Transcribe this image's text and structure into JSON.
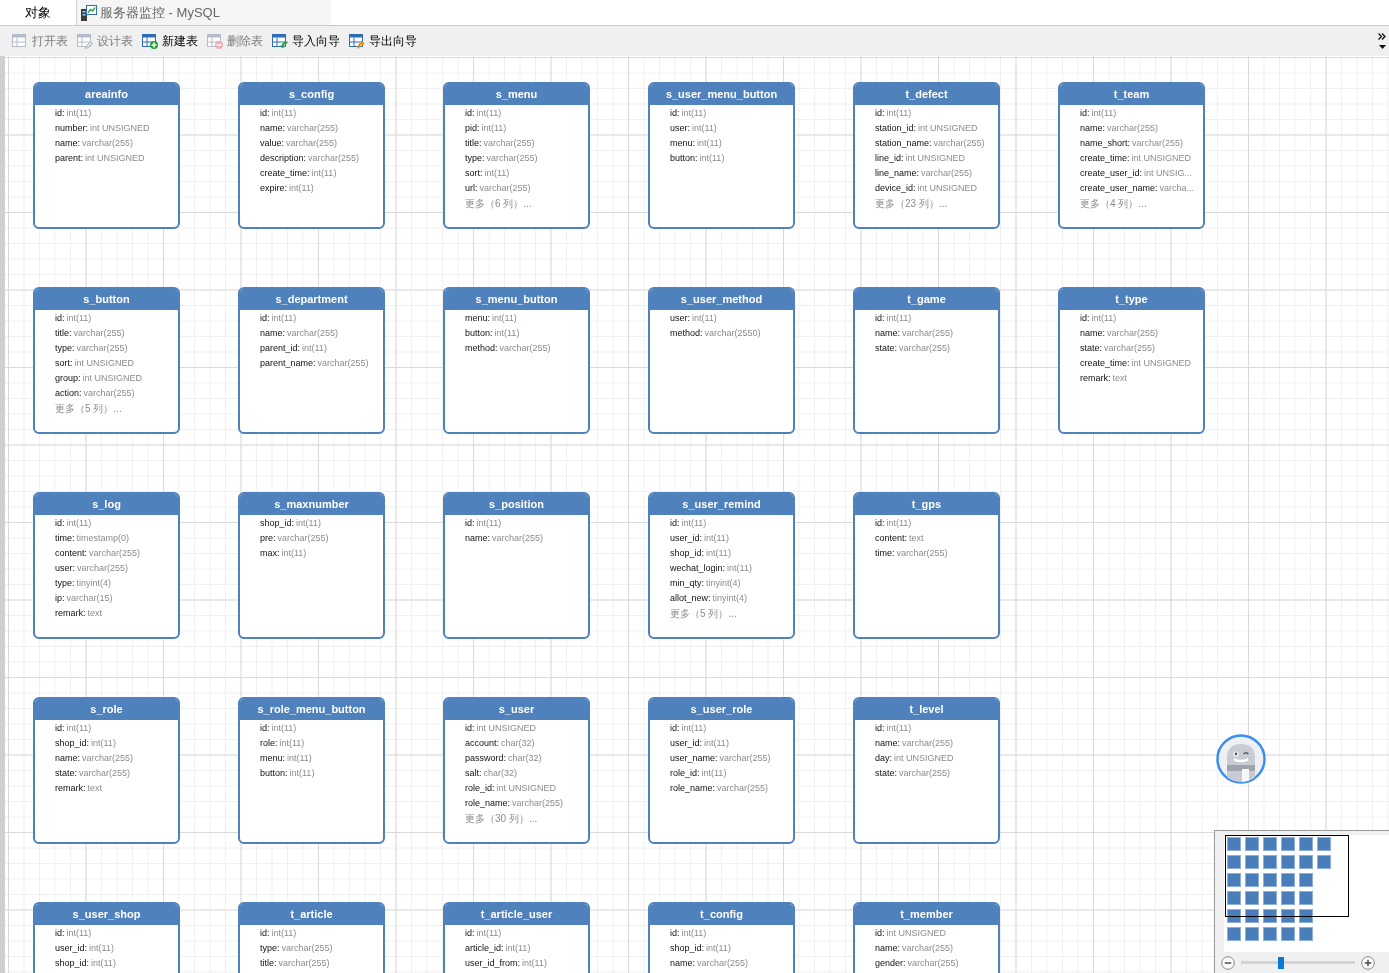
{
  "tabs": [
    {
      "label": "对象",
      "selected": true,
      "kind": "objects"
    },
    {
      "label": "服务器监控 - MySQL",
      "selected": false,
      "kind": "server-monitor"
    }
  ],
  "toolbar": [
    {
      "label": "打开表",
      "kind": "open",
      "disabled": true
    },
    {
      "label": "设计表",
      "kind": "design",
      "disabled": true
    },
    {
      "label": "新建表",
      "kind": "new",
      "disabled": false
    },
    {
      "label": "删除表",
      "kind": "delete",
      "disabled": true
    },
    {
      "label": "导入向导",
      "kind": "import",
      "disabled": false
    },
    {
      "label": "导出向导",
      "kind": "export",
      "disabled": false
    }
  ],
  "table_rows": [
    [
      {
        "name": "areainfo",
        "fields": [
          {
            "name": "id:",
            "type": "int(11)"
          },
          {
            "name": "number:",
            "type": "int UNSIGNED"
          },
          {
            "name": "name:",
            "type": "varchar(255)"
          },
          {
            "name": "parent:",
            "type": "int UNSIGNED"
          }
        ]
      },
      {
        "name": "s_config",
        "fields": [
          {
            "name": "id:",
            "type": "int(11)"
          },
          {
            "name": "name:",
            "type": "varchar(255)"
          },
          {
            "name": "value:",
            "type": "varchar(255)"
          },
          {
            "name": "description:",
            "type": "varchar(255)"
          },
          {
            "name": "create_time:",
            "type": "int(11)"
          },
          {
            "name": "expire:",
            "type": "int(11)"
          }
        ]
      },
      {
        "name": "s_menu",
        "fields": [
          {
            "name": "id:",
            "type": "int(11)"
          },
          {
            "name": "pid:",
            "type": "int(11)"
          },
          {
            "name": "title:",
            "type": "varchar(255)"
          },
          {
            "name": "type:",
            "type": "varchar(255)"
          },
          {
            "name": "sort:",
            "type": "int(11)"
          },
          {
            "name": "url:",
            "type": "varchar(255)"
          }
        ],
        "more": "更多（6 列）..."
      },
      {
        "name": "s_user_menu_button",
        "fields": [
          {
            "name": "id:",
            "type": "int(11)"
          },
          {
            "name": "user:",
            "type": "int(11)"
          },
          {
            "name": "menu:",
            "type": "int(11)"
          },
          {
            "name": "button:",
            "type": "int(11)"
          }
        ]
      },
      {
        "name": "t_defect",
        "fields": [
          {
            "name": "id:",
            "type": "int(11)"
          },
          {
            "name": "station_id:",
            "type": "int UNSIGNED"
          },
          {
            "name": "station_name:",
            "type": "varchar(255)"
          },
          {
            "name": "line_id:",
            "type": "int UNSIGNED"
          },
          {
            "name": "line_name:",
            "type": "varchar(255)"
          },
          {
            "name": "device_id:",
            "type": "int UNSIGNED"
          }
        ],
        "more": "更多（23 列）..."
      },
      {
        "name": "t_team",
        "fields": [
          {
            "name": "id:",
            "type": "int(11)"
          },
          {
            "name": "name:",
            "type": "varchar(255)"
          },
          {
            "name": "name_short:",
            "type": "varchar(255)"
          },
          {
            "name": "create_time:",
            "type": "int UNSIGNED"
          },
          {
            "name": "create_user_id:",
            "type": "int UNSIG..."
          },
          {
            "name": "create_user_name:",
            "type": "varcha..."
          }
        ],
        "more": "更多（4 列）..."
      }
    ],
    [
      {
        "name": "s_button",
        "fields": [
          {
            "name": "id:",
            "type": "int(11)"
          },
          {
            "name": "title:",
            "type": "varchar(255)"
          },
          {
            "name": "type:",
            "type": "varchar(255)"
          },
          {
            "name": "sort:",
            "type": "int UNSIGNED"
          },
          {
            "name": "group:",
            "type": "int UNSIGNED"
          },
          {
            "name": "action:",
            "type": "varchar(255)"
          }
        ],
        "more": "更多（5 列）..."
      },
      {
        "name": "s_department",
        "fields": [
          {
            "name": "id:",
            "type": "int(11)"
          },
          {
            "name": "name:",
            "type": "varchar(255)"
          },
          {
            "name": "parent_id:",
            "type": "int(11)"
          },
          {
            "name": "parent_name:",
            "type": "varchar(255)"
          }
        ]
      },
      {
        "name": "s_menu_button",
        "fields": [
          {
            "name": "menu:",
            "type": "int(11)"
          },
          {
            "name": "button:",
            "type": "int(11)"
          },
          {
            "name": "method:",
            "type": "varchar(255)"
          }
        ]
      },
      {
        "name": "s_user_method",
        "fields": [
          {
            "name": "user:",
            "type": "int(11)"
          },
          {
            "name": "method:",
            "type": "varchar(2550)"
          }
        ]
      },
      {
        "name": "t_game",
        "fields": [
          {
            "name": "id:",
            "type": "int(11)"
          },
          {
            "name": "name:",
            "type": "varchar(255)"
          },
          {
            "name": "state:",
            "type": "varchar(255)"
          }
        ]
      },
      {
        "name": "t_type",
        "fields": [
          {
            "name": "id:",
            "type": "int(11)"
          },
          {
            "name": "name:",
            "type": "varchar(255)"
          },
          {
            "name": "state:",
            "type": "varchar(255)"
          },
          {
            "name": "create_time:",
            "type": "int UNSIGNED"
          },
          {
            "name": "remark:",
            "type": "text"
          }
        ]
      }
    ],
    [
      {
        "name": "s_log",
        "fields": [
          {
            "name": "id:",
            "type": "int(11)"
          },
          {
            "name": "time:",
            "type": "timestamp(0)"
          },
          {
            "name": "content:",
            "type": "varchar(255)"
          },
          {
            "name": "user:",
            "type": "varchar(255)"
          },
          {
            "name": "type:",
            "type": "tinyint(4)"
          },
          {
            "name": "ip:",
            "type": "varchar(15)"
          },
          {
            "name": "remark:",
            "type": "text"
          }
        ]
      },
      {
        "name": "s_maxnumber",
        "fields": [
          {
            "name": "shop_id:",
            "type": "int(11)"
          },
          {
            "name": "pre:",
            "type": "varchar(255)"
          },
          {
            "name": "max:",
            "type": "int(11)"
          }
        ]
      },
      {
        "name": "s_position",
        "fields": [
          {
            "name": "id:",
            "type": "int(11)"
          },
          {
            "name": "name:",
            "type": "varchar(255)"
          }
        ]
      },
      {
        "name": "s_user_remind",
        "fields": [
          {
            "name": "id:",
            "type": "int(11)"
          },
          {
            "name": "user_id:",
            "type": "int(11)"
          },
          {
            "name": "shop_id:",
            "type": "int(11)"
          },
          {
            "name": "wechat_login:",
            "type": "int(11)"
          },
          {
            "name": "min_qty:",
            "type": "tinyint(4)"
          },
          {
            "name": "allot_new:",
            "type": "tinyint(4)"
          }
        ],
        "more": "更多（5 列）..."
      },
      {
        "name": "t_gps",
        "fields": [
          {
            "name": "id:",
            "type": "int(11)"
          },
          {
            "name": "content:",
            "type": "text"
          },
          {
            "name": "time:",
            "type": "varchar(255)"
          }
        ]
      }
    ],
    [
      {
        "name": "s_role",
        "fields": [
          {
            "name": "id:",
            "type": "int(11)"
          },
          {
            "name": "shop_id:",
            "type": "int(11)"
          },
          {
            "name": "name:",
            "type": "varchar(255)"
          },
          {
            "name": "state:",
            "type": "varchar(255)"
          },
          {
            "name": "remark:",
            "type": "text"
          }
        ]
      },
      {
        "name": "s_role_menu_button",
        "fields": [
          {
            "name": "id:",
            "type": "int(11)"
          },
          {
            "name": "role:",
            "type": "int(11)"
          },
          {
            "name": "menu:",
            "type": "int(11)"
          },
          {
            "name": "button:",
            "type": "int(11)"
          }
        ]
      },
      {
        "name": "s_user",
        "fields": [
          {
            "name": "id:",
            "type": "int UNSIGNED"
          },
          {
            "name": "account:",
            "type": "char(32)"
          },
          {
            "name": "password:",
            "type": "char(32)"
          },
          {
            "name": "salt:",
            "type": "char(32)"
          },
          {
            "name": "role_id:",
            "type": "int UNSIGNED"
          },
          {
            "name": "role_name:",
            "type": "varchar(255)"
          }
        ],
        "more": "更多（30 列）..."
      },
      {
        "name": "s_user_role",
        "fields": [
          {
            "name": "id:",
            "type": "int(11)"
          },
          {
            "name": "user_id:",
            "type": "int(11)"
          },
          {
            "name": "user_name:",
            "type": "varchar(255)"
          },
          {
            "name": "role_id:",
            "type": "int(11)"
          },
          {
            "name": "role_name:",
            "type": "varchar(255)"
          }
        ]
      },
      {
        "name": "t_level",
        "fields": [
          {
            "name": "id:",
            "type": "int(11)"
          },
          {
            "name": "name:",
            "type": "varchar(255)"
          },
          {
            "name": "day:",
            "type": "int UNSIGNED"
          },
          {
            "name": "state:",
            "type": "varchar(255)"
          }
        ]
      }
    ],
    [
      {
        "name": "s_user_shop",
        "fields": [
          {
            "name": "id:",
            "type": "int(11)"
          },
          {
            "name": "user_id:",
            "type": "int(11)"
          },
          {
            "name": "shop_id:",
            "type": "int(11)"
          }
        ]
      },
      {
        "name": "t_article",
        "fields": [
          {
            "name": "id:",
            "type": "int(11)"
          },
          {
            "name": "type:",
            "type": "varchar(255)"
          },
          {
            "name": "title:",
            "type": "varchar(255)"
          }
        ]
      },
      {
        "name": "t_article_user",
        "fields": [
          {
            "name": "id:",
            "type": "int(11)"
          },
          {
            "name": "article_id:",
            "type": "int(11)"
          },
          {
            "name": "user_id_from:",
            "type": "int(11)"
          }
        ]
      },
      {
        "name": "t_config",
        "fields": [
          {
            "name": "id:",
            "type": "int(11)"
          },
          {
            "name": "shop_id:",
            "type": "int(11)"
          },
          {
            "name": "name:",
            "type": "varchar(255)"
          }
        ]
      },
      {
        "name": "t_member",
        "fields": [
          {
            "name": "id:",
            "type": "int UNSIGNED"
          },
          {
            "name": "name:",
            "type": "varchar(255)"
          },
          {
            "name": "gender:",
            "type": "varchar(255)"
          }
        ]
      }
    ]
  ],
  "minimap": {
    "zoom": {
      "level": 0.35
    }
  }
}
